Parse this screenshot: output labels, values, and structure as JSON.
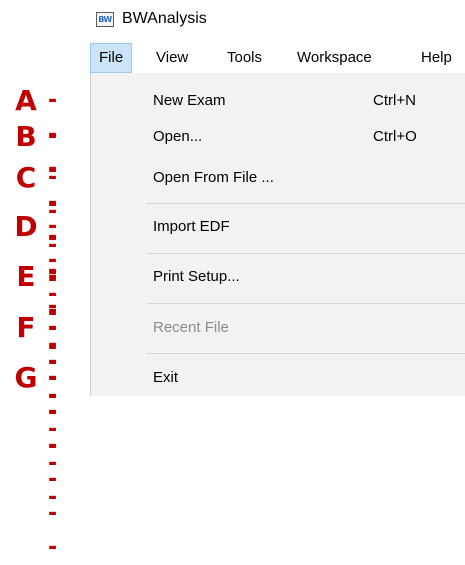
{
  "window": {
    "icon_text": "BW",
    "title": "BWAnalysis"
  },
  "menubar": {
    "items": [
      "File",
      "View",
      "Tools",
      "Workspace",
      "Help"
    ]
  },
  "file_menu": {
    "items": [
      {
        "label": "New Exam",
        "shortcut": "Ctrl+N",
        "enabled": true
      },
      {
        "label": "Open...",
        "shortcut": "Ctrl+O",
        "enabled": true
      },
      {
        "label": "Open From File ...",
        "shortcut": "",
        "enabled": true
      },
      {
        "label": "Import EDF",
        "shortcut": "",
        "enabled": true
      },
      {
        "label": "Print Setup...",
        "shortcut": "",
        "enabled": true
      },
      {
        "label": "Recent File",
        "shortcut": "",
        "enabled": false
      },
      {
        "label": "Exit",
        "shortcut": "",
        "enabled": true
      }
    ]
  },
  "callouts": {
    "letters": [
      "A",
      "B",
      "C",
      "D",
      "E",
      "F",
      "G"
    ],
    "dash": "------",
    "color": "#c00000"
  },
  "colors": {
    "menu_highlight": "#cce4f7",
    "dropdown_bg": "#f2f2f2"
  }
}
